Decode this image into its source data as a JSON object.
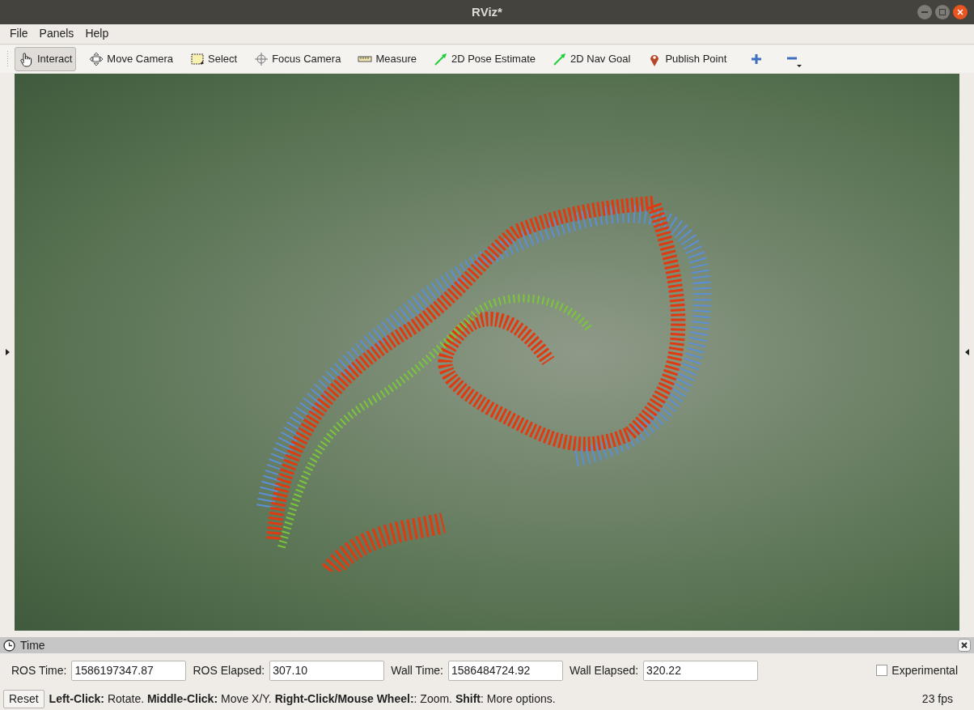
{
  "window": {
    "title": "RViz*"
  },
  "menu": [
    "File",
    "Panels",
    "Help"
  ],
  "tools": [
    {
      "label": "Interact",
      "selected": true
    },
    {
      "label": "Move Camera",
      "selected": false
    },
    {
      "label": "Select",
      "selected": false
    },
    {
      "label": "Focus Camera",
      "selected": false
    },
    {
      "label": "Measure",
      "selected": false
    },
    {
      "label": "2D Pose Estimate",
      "selected": false
    },
    {
      "label": "2D Nav Goal",
      "selected": false
    },
    {
      "label": "Publish Point",
      "selected": false
    }
  ],
  "time_panel": {
    "title": "Time",
    "fields": [
      {
        "label": "ROS Time:",
        "value": "1586197347.87"
      },
      {
        "label": "ROS Elapsed:",
        "value": "307.10"
      },
      {
        "label": "Wall Time:",
        "value": "1586484724.92"
      },
      {
        "label": "Wall Elapsed:",
        "value": "320.22"
      }
    ],
    "experimental": {
      "label": "Experimental",
      "checked": false
    }
  },
  "status_bar": {
    "reset": "Reset",
    "hint": "**Left-Click:** Rotate. **Middle-Click:** Move X/Y. **Right-Click/Mouse Wheel:**: Zoom. **Shift**: More options.",
    "fps": "23 fps"
  }
}
